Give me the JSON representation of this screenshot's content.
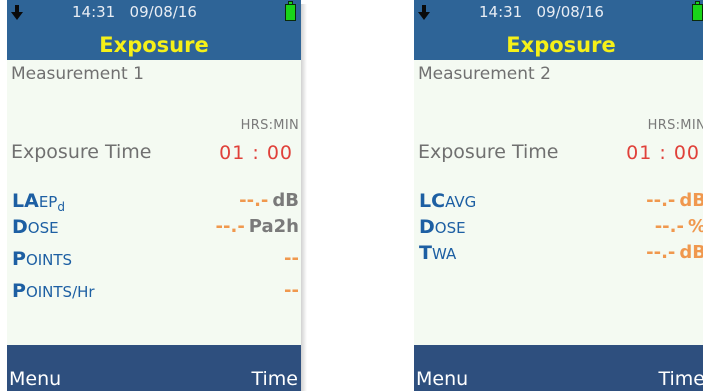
{
  "screens": [
    {
      "status": {
        "time": "14:31",
        "date": "09/08/16",
        "download_icon": "down-arrow-icon",
        "battery_icon": "battery-full-icon",
        "battery_color": "#19d419"
      },
      "title": "Exposure",
      "measurement_name": "Measurement 1",
      "time_units": "HRS:MIN",
      "exposure_time_label": "Exposure Time",
      "exposure_time_value": "01 : 00",
      "rows": [
        {
          "initial": "LA",
          "rest": "EP",
          "sub": "d",
          "value": "--.-",
          "unit": "dB",
          "unit_style": "gray"
        },
        {
          "initial": "D",
          "rest": "OSE",
          "sub": "",
          "value": "--.-",
          "unit": "Pa2h",
          "unit_style": "gray"
        },
        {
          "initial": "P",
          "rest": "OINTS",
          "sub": "",
          "value": "--",
          "unit": "",
          "unit_style": "gray"
        },
        {
          "initial": "P",
          "rest": "OINTS/Hr",
          "sub": "",
          "value": "--",
          "unit": "",
          "unit_style": "gray"
        }
      ],
      "softkeys": {
        "left": "Menu",
        "right": "Time"
      }
    },
    {
      "status": {
        "time": "14:31",
        "date": "09/08/16",
        "download_icon": "down-arrow-icon",
        "battery_icon": "battery-full-icon",
        "battery_color": "#19d419"
      },
      "title": "Exposure",
      "measurement_name": "Measurement 2",
      "time_units": "HRS:MIN",
      "exposure_time_label": "Exposure Time",
      "exposure_time_value": "01 : 00",
      "rows": [
        {
          "initial": "LC",
          "rest": "AVG",
          "sub": "",
          "value": "--.-",
          "unit": "dB",
          "unit_style": "orange"
        },
        {
          "initial": "D",
          "rest": "OSE",
          "sub": "",
          "value": "--.-",
          "unit": "%",
          "unit_style": "orange"
        },
        {
          "initial": "T",
          "rest": "WA",
          "sub": "",
          "value": "--.-",
          "unit": "dB",
          "unit_style": "orange"
        }
      ],
      "softkeys": {
        "left": "Menu",
        "right": "Time"
      }
    }
  ],
  "colors": {
    "header_bg": "#2e6497",
    "title_text": "#f5f018",
    "label_blue": "#1d5fa3",
    "value_orange": "#f0984e",
    "time_red": "#e0413a",
    "footer_bg": "#2e4f7e",
    "screen_bg": "#f4faf2"
  }
}
